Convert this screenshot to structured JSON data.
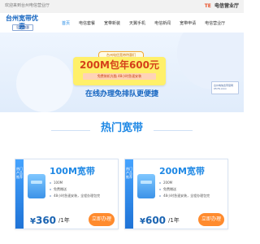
{
  "topbar": {
    "welcome": "欢迎来到台州电信营业厅",
    "hotline_label": "TE",
    "hotline_number": "电信营业厅"
  },
  "header": {
    "logo": {
      "title": "台州宽带优惠",
      "subtitle": "官方特惠"
    },
    "nav": [
      {
        "label": "首页"
      },
      {
        "label": "电信套餐"
      },
      {
        "label": "宽带新装"
      },
      {
        "label": "天翼手机"
      },
      {
        "label": "电信新闻"
      },
      {
        "label": "宽带申请"
      },
      {
        "label": "电信营业厅"
      }
    ]
  },
  "banner": {
    "pill": "台州电信宽带特惠们",
    "headline": "200M包年600元",
    "subtags": "免费装机光猫 48小时急速安装",
    "slogan": "在线办理免排队更便捷",
    "sidebox": "台州电信宽带官网 0576-xxxx"
  },
  "section": {
    "title": "热门宽带"
  },
  "plans": [
    {
      "strip": "热门产品推荐",
      "name": "100M宽带",
      "features": [
        "100M",
        "免费赠送",
        "48小时急速安装，全程办理包完"
      ],
      "price_symbol": "¥",
      "price": "360",
      "unit": "/1年",
      "button": "立即办理"
    },
    {
      "strip": "热门产品推荐",
      "name": "200M宽带",
      "features": [
        "200M",
        "免费赠送",
        "48小时急速安装，全程办理包完"
      ],
      "price_symbol": "¥",
      "price": "600",
      "unit": "/1年",
      "button": "立即办理"
    }
  ]
}
